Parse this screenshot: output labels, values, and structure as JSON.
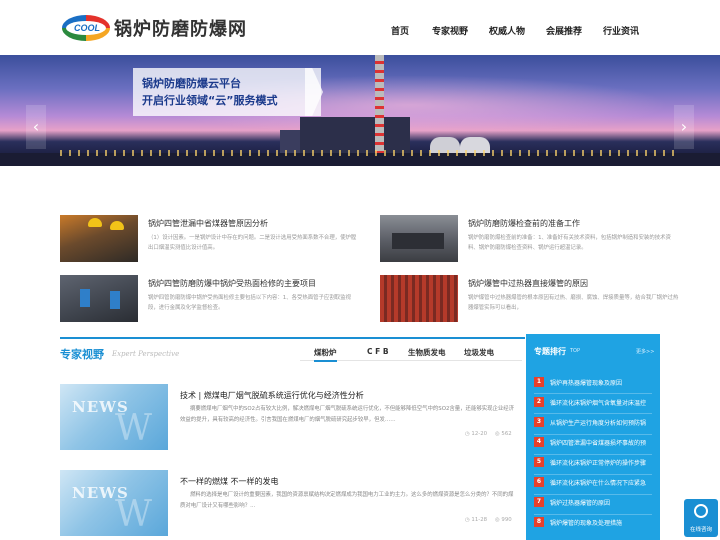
{
  "header": {
    "logo_text": "COOL",
    "site_name": "锅炉防磨防爆网",
    "nav": [
      "首页",
      "专家视野",
      "权威人物",
      "会展推荐",
      "行业资讯"
    ]
  },
  "banner": {
    "line1": "锅炉防磨防爆云平台",
    "line2": "开启行业领域“云”服务模式",
    "prev": "‹",
    "next": "›"
  },
  "articles": [
    {
      "title": "锅炉四管泄漏中省煤器管原因分析",
      "summary": "（1）设计因素。一是锅炉设计中存在的问题。二是设计选用受热面系数不合理，使炉膛出口烟温实测值比设计值高。"
    },
    {
      "title": "锅炉防磨防爆检查前的准备工作",
      "summary": "锅炉防磨防爆检查前的准备：1、准备好有关技术资料，包括锅炉制造和安装的技术资料、锅炉防磨防爆检查资料、锅炉运行超温记录。"
    },
    {
      "title": "锅炉四管防磨防爆中锅炉受热面检修的主要项目",
      "summary": "锅炉四管防磨防爆中锅炉受热面检修主要包括以下内容：1、各受热面管子应割取监视段，进行金属及化学监督检查。"
    },
    {
      "title": "锅炉爆管中过热器直接爆管的原因",
      "summary": "锅炉爆管中过热器爆管的根本原因有过热、磨损、腐蚀、焊接质量等，结合我厂锅炉过热器爆管实际可以看出，"
    }
  ],
  "expert": {
    "title": "专家视野",
    "subtitle": "Expert Perspective",
    "tabs": [
      "煤粉炉",
      "C F B",
      "生物质发电",
      "垃圾发电"
    ],
    "items": [
      {
        "title": "技术 | 燃煤电厂烟气脱硫系统运行优化与经济性分析",
        "summary": "摘要燃煤电厂烟气中的SO2占有较大比例，解决燃煤电厂烟气脱硫系统运行优化，不但能够降低空气中的SO2含量，还能够实现企业经济效益的提升，具有较高的经济性。引言我国在燃煤电厂的烟气脱硫研究起步较早，但发……",
        "date": "12-20",
        "views": "562",
        "image_text": "NEWS"
      },
      {
        "title": "不一样的燃煤 不一样的发电",
        "summary": "燃料的选择是电厂设计的重要因素，我国的资源禀赋结构决定燃煤成为我国电力工业的主力。这么多的燃煤资源是怎么分类的？不同的煤质对电厂设计又有哪些影响？...",
        "date": "11-28",
        "views": "990",
        "image_text": "NEWS"
      }
    ]
  },
  "ranking": {
    "title": "专题排行",
    "top_label": "TOP",
    "more": "更多>>",
    "items": [
      {
        "num": "1",
        "text": "锅炉再热器爆管现象及原因"
      },
      {
        "num": "2",
        "text": "循环流化床锅炉烟气含氧量对床温控"
      },
      {
        "num": "3",
        "text": "从锅炉生产运行角度分析如何预防锅"
      },
      {
        "num": "4",
        "text": "锅炉四管泄漏中省煤器损坏事故的预"
      },
      {
        "num": "5",
        "text": "循环流化床锅炉正常停炉的操作步骤"
      },
      {
        "num": "6",
        "text": "循环流化床锅炉在什么情况下应紧急"
      },
      {
        "num": "7",
        "text": "锅炉过热器爆管的原因"
      },
      {
        "num": "8",
        "text": "锅炉爆管的现象及处理措施"
      }
    ]
  },
  "consult": {
    "label": "在线咨询"
  },
  "colors": {
    "accent": "#1a8fd3",
    "rank_bg": "#1fa3e3",
    "rank_badge": "#e8402b"
  }
}
